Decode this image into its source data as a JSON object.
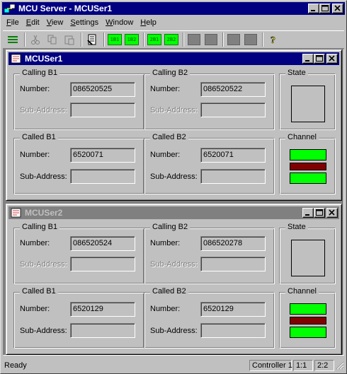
{
  "app": {
    "title": "MCU Server - MCUSer1"
  },
  "menu": [
    {
      "label": "File",
      "hotkey": "F",
      "rest": "ile"
    },
    {
      "label": "Edit",
      "hotkey": "E",
      "rest": "dit"
    },
    {
      "label": "View",
      "hotkey": "V",
      "rest": "iew"
    },
    {
      "label": "Settings",
      "hotkey": "S",
      "rest": "ettings"
    },
    {
      "label": "Window",
      "hotkey": "W",
      "rest": "indow"
    },
    {
      "label": "Help",
      "hotkey": "H",
      "rest": "elp"
    }
  ],
  "toolbar": {
    "icons": [
      "menu-lines-icon",
      "cut-icon",
      "copy-icon",
      "paste-icon",
      "document-icon",
      "help-icon"
    ],
    "leds": [
      "1B1",
      "1B2",
      "2B1",
      "2B2"
    ]
  },
  "colors": {
    "title_active": "#000080",
    "title_inactive": "#808080",
    "channel_green": "#00ff00",
    "channel_red": "#800000"
  },
  "windows": [
    {
      "title": "MCUSer1",
      "active": true,
      "calling_b1": {
        "title": "Calling B1",
        "number_label": "Number:",
        "number": "086520525",
        "sub_label": "Sub-Address:",
        "sub": ""
      },
      "calling_b2": {
        "title": "Calling B2",
        "number_label": "Number:",
        "number": "086520522",
        "sub_label": "Sub-Address:",
        "sub": ""
      },
      "called_b1": {
        "title": "Called B1",
        "number_label": "Number:",
        "number": "6520071",
        "sub_label": "Sub-Address:",
        "sub": ""
      },
      "called_b2": {
        "title": "Called B2",
        "number_label": "Number:",
        "number": "6520071",
        "sub_label": "Sub-Address:",
        "sub": ""
      },
      "state": {
        "title": "State"
      },
      "channel": {
        "title": "Channel",
        "bars": [
          "green",
          "red",
          "green"
        ]
      }
    },
    {
      "title": "MCUSer2",
      "active": false,
      "calling_b1": {
        "title": "Calling B1",
        "number_label": "Number:",
        "number": "086520524",
        "sub_label": "Sub-Address:",
        "sub": ""
      },
      "calling_b2": {
        "title": "Calling B2",
        "number_label": "Number:",
        "number": "086520278",
        "sub_label": "Sub-Address:",
        "sub": ""
      },
      "called_b1": {
        "title": "Called B1",
        "number_label": "Number:",
        "number": "6520129",
        "sub_label": "Sub-Address:",
        "sub": ""
      },
      "called_b2": {
        "title": "Called B2",
        "number_label": "Number:",
        "number": "6520129",
        "sub_label": "Sub-Address:",
        "sub": ""
      },
      "state": {
        "title": "State"
      },
      "channel": {
        "title": "Channel",
        "bars": [
          "green",
          "red",
          "green"
        ]
      }
    }
  ],
  "status": {
    "text": "Ready",
    "panels": [
      "Controller 1",
      "1:1",
      "2:2"
    ]
  }
}
